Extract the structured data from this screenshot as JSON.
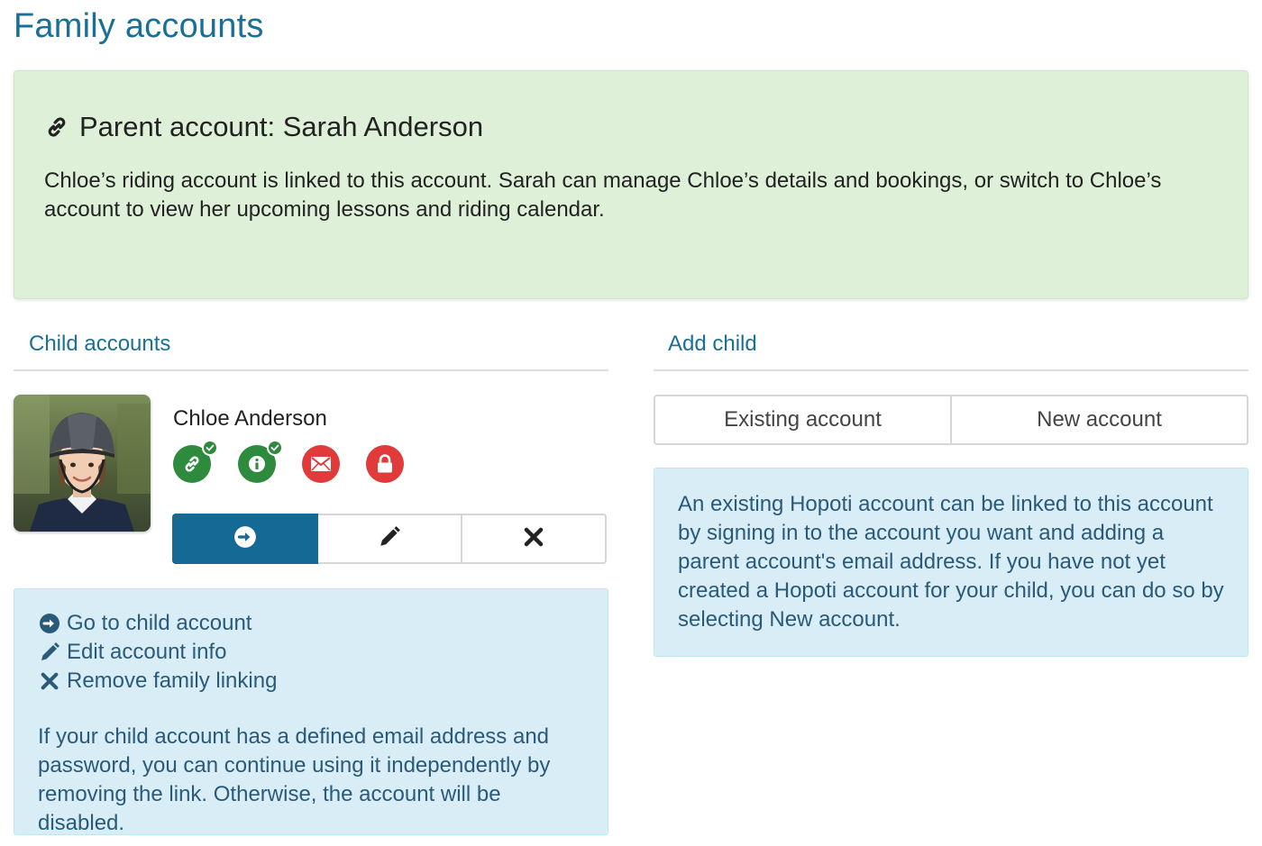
{
  "page": {
    "title": "Family accounts"
  },
  "parent_panel": {
    "heading": "Parent account: Sarah Anderson",
    "body": "Chloe’s riding account is linked to this account. Sarah can manage Chloe’s details and bookings, or switch to Chloe’s account to view her upcoming lessons and riding calendar.",
    "icon": "link-icon",
    "background": "#dff0d8"
  },
  "child_section": {
    "title": "Child accounts",
    "child": {
      "name": "Chloe Anderson",
      "avatar": "avatar",
      "status_icons": [
        {
          "name": "linked-status-icon",
          "color": "#2e8b3e",
          "checked": true
        },
        {
          "name": "info-status-icon",
          "color": "#2e8b3e",
          "checked": true
        },
        {
          "name": "email-status-icon",
          "color": "#e03a3a",
          "checked": false
        },
        {
          "name": "lock-status-icon",
          "color": "#e03a3a",
          "checked": false
        }
      ],
      "actions": [
        {
          "name": "go-to-child-button",
          "icon": "arrow-circle-right-icon"
        },
        {
          "name": "edit-account-button",
          "icon": "pencil-icon"
        },
        {
          "name": "remove-link-button",
          "icon": "close-icon"
        }
      ]
    },
    "legend": {
      "items": [
        {
          "icon": "arrow-circle-right-icon",
          "label": "Go to child account"
        },
        {
          "icon": "pencil-icon",
          "label": "Edit account info"
        },
        {
          "icon": "close-icon",
          "label": "Remove family linking"
        }
      ],
      "note": "If your child account has a defined email address and password, you can continue using it independently by removing the link. Otherwise, the account will be disabled."
    }
  },
  "add_child_section": {
    "title": "Add child",
    "tabs": [
      {
        "label": "Existing account",
        "selected": false
      },
      {
        "label": "New account",
        "selected": false
      }
    ],
    "info": "An existing Hopoti account can be linked to this account by signing in to the account you want and adding a parent account's email address. If you have not yet created a Hopoti account for your child, you can do so by selecting New account."
  },
  "colors": {
    "accent": "#1a6f96",
    "primary_button": "#156a95",
    "info_background": "#d9edf7",
    "info_text": "#2a5a7a",
    "status_ok": "#2e8b3e",
    "status_missing": "#e03a3a"
  }
}
